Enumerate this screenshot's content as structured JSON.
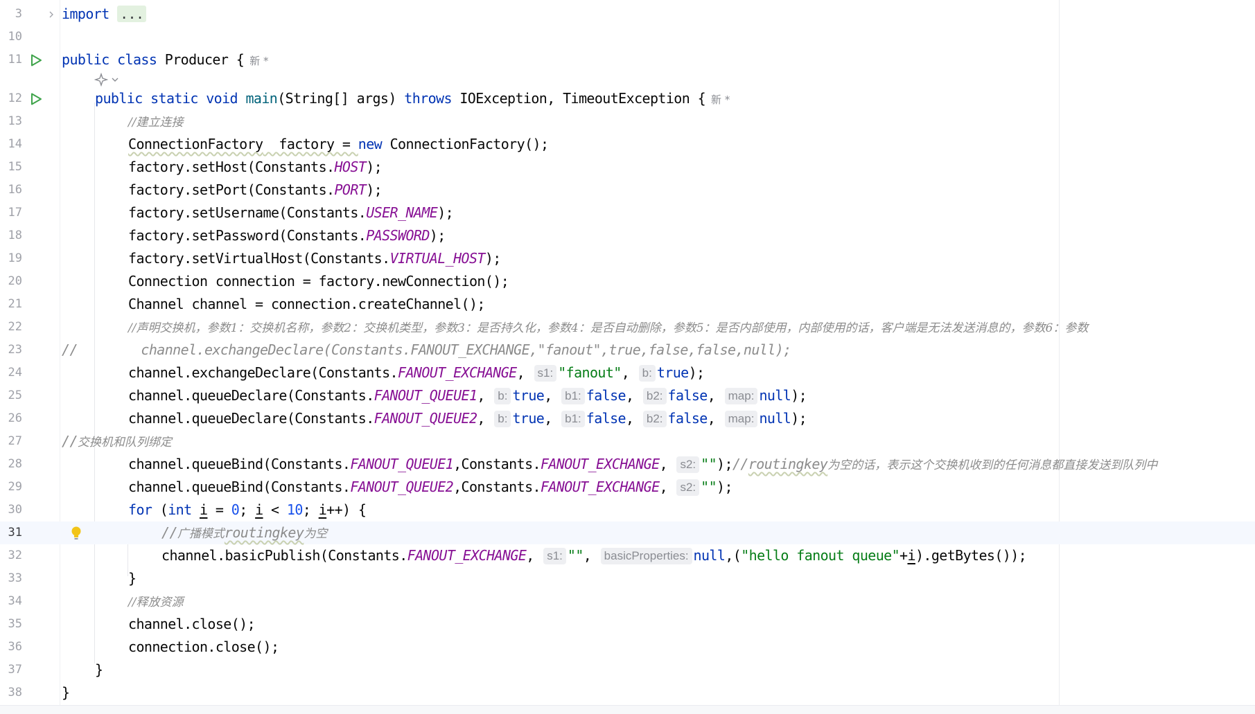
{
  "editor": {
    "line_numbers": [
      "3",
      "10",
      "11",
      "12",
      "13",
      "14",
      "15",
      "16",
      "17",
      "18",
      "19",
      "20",
      "21",
      "22",
      "23",
      "24",
      "25",
      "26",
      "27",
      "28",
      "29",
      "30",
      "31",
      "32",
      "33",
      "34",
      "35",
      "36",
      "37",
      "38"
    ],
    "import_kw": "import",
    "import_folded": "...",
    "author_label": "新 *",
    "hints": {
      "s1": "s1:",
      "b": "b:",
      "b1": "b1:",
      "b2": "b2:",
      "map": "map:",
      "s2": "s2:",
      "basicProperties": "basicProperties:"
    },
    "comments": {
      "c13": "//建立连接",
      "c22": "//声明交换机，参数1：交换机名称，参数2：交换机类型，参数3：是否持久化，参数4：是否自动删除，参数5：是否内部使用，内部使用的话，客户端是无法发送消息的，参数6：参数",
      "c23": "//        channel.exchangeDeclare(Constants.FANOUT_EXCHANGE,\"fanout\",true,false,false,null);",
      "c27_slash": "//",
      "c27_text": "交换机和队列绑定",
      "c28_slash": "//",
      "c28_word": "routingkey",
      "c28_text": "为空的话，表示这个交换机收到的任何消息都直接发送到队列中",
      "c31_slash": "//",
      "c31_zh": "广播模式",
      "c31_word": "routingkey",
      "c31_tail": "为空",
      "c34": "//释放资源"
    },
    "strings": {
      "fanout": "\"fanout\"",
      "empty": "\"\"",
      "hello": "\"hello fanout queue\""
    },
    "numbers": {
      "zero": "0",
      "ten": "10"
    },
    "constants": {
      "HOST": "HOST",
      "PORT": "PORT",
      "USER_NAME": "USER_NAME",
      "PASSWORD": "PASSWORD",
      "VIRTUAL_HOST": "VIRTUAL_HOST",
      "FANOUT_EXCHANGE": "FANOUT_EXCHANGE",
      "FANOUT_QUEUE1": "FANOUT_QUEUE1",
      "FANOUT_QUEUE2": "FANOUT_QUEUE2"
    },
    "keywords": {
      "public": "public",
      "class": "class",
      "static": "static",
      "void": "void",
      "throws": "throws",
      "new": "new",
      "true": "true",
      "false": "false",
      "null": "null",
      "for": "for",
      "int": "int"
    },
    "code": {
      "l11_name": " Producer {",
      "l12_main": "main",
      "l12_sig": "(String[] args) ",
      "l12_exc": " IOException, TimeoutException {",
      "l14_type": "ConnectionFactory",
      "l14_var": "  factory = ",
      "l14_ctor": " ConnectionFactory();",
      "l15_pre": "factory.setHost(Constants.",
      "l16_pre": "factory.setPort(Constants.",
      "l17_pre": "factory.setUsername(Constants.",
      "l18_pre": "factory.setPassword(Constants.",
      "l19_pre": "factory.setVirtualHost(Constants.",
      "close_stmt": ");",
      "l20": "Connection connection = factory.newConnection();",
      "l21": "Channel channel = connection.createChannel();",
      "l24_pre": "channel.exchangeDeclare(Constants.",
      "l25_pre": "channel.queueDeclare(Constants.",
      "l26_pre": "channel.queueDeclare(Constants.",
      "comma": ",",
      "comma_sp": ", ",
      "l28_pre": "channel.queueBind(Constants.",
      "l28_mid": ",Constants.",
      "l28_end": ");",
      "l29_pre": "channel.queueBind(Constants.",
      "l30_open": " (",
      "i": "i",
      "eq": " = ",
      "semi": "; ",
      "lt": " < ",
      "inc": "++) {",
      "l32_pre": "channel.basicPublish(Constants.",
      "l32_paren": ",(",
      "l32_plus": "+",
      "l32_end": ").getBytes());",
      "brace_close": "}",
      "l35": "channel.close();",
      "l36": "connection.close();"
    }
  },
  "colors": {
    "keyword": "#0033b3",
    "constant": "#871094",
    "string": "#067d17",
    "number": "#1750eb",
    "comment": "#8c8c8c",
    "run_icon": "#3ea34a",
    "bulb": "#f2c418"
  }
}
